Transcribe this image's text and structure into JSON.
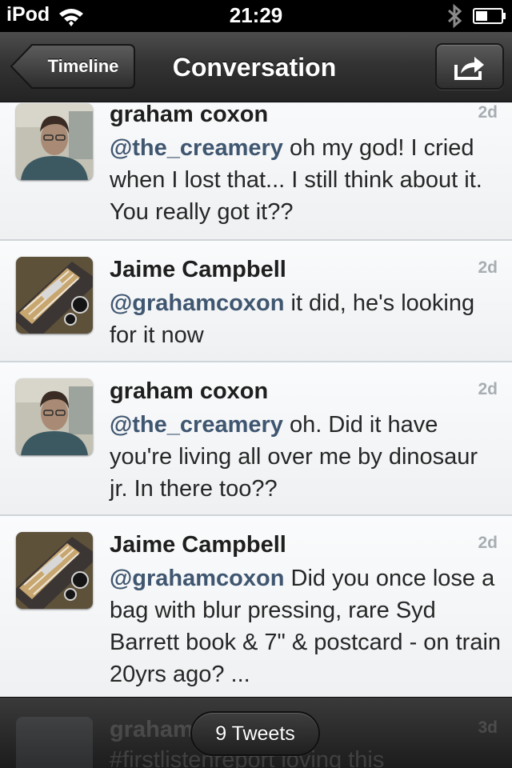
{
  "status_bar": {
    "carrier": "iPod",
    "time": "21:29",
    "wifi_icon": "wifi-icon",
    "bluetooth_icon": "bluetooth-icon",
    "battery_icon": "battery-icon",
    "battery_level": 0.45
  },
  "nav": {
    "back_label": "Timeline",
    "title": "Conversation",
    "share_icon": "share-icon"
  },
  "tweets": [
    {
      "name": "graham coxon",
      "time": "2d",
      "mention": "@the_creamery",
      "text": " oh my god! I cried when I lost that... I still think about it. You really got it??",
      "avatar": "person-photo"
    },
    {
      "name": "Jaime Campbell",
      "time": "2d",
      "mention": "@grahamcoxon",
      "text": " it did, he's looking for it now",
      "avatar": "guitar-photo"
    },
    {
      "name": "graham coxon",
      "time": "2d",
      "mention": "@the_creamery",
      "text": " oh. Did it have you're living all over me by dinosaur jr. In there too??",
      "avatar": "person-photo"
    },
    {
      "name": "Jaime Campbell",
      "time": "2d",
      "mention": "@grahamcoxon",
      "text": " Did you once lose a bag with blur pressing, rare Syd Barrett book & 7\" & postcard - on train 20yrs ago? ...",
      "avatar": "guitar-photo"
    }
  ],
  "partial_tweet": {
    "name": "graham",
    "time": "3d",
    "text": "#firstlistenreport loving this"
  },
  "toolbar": {
    "tweet_count_label": "9 Tweets"
  },
  "colors": {
    "mention": "#3f5670",
    "nav_bar": "#333333",
    "timestamp": "#a7adb2"
  }
}
